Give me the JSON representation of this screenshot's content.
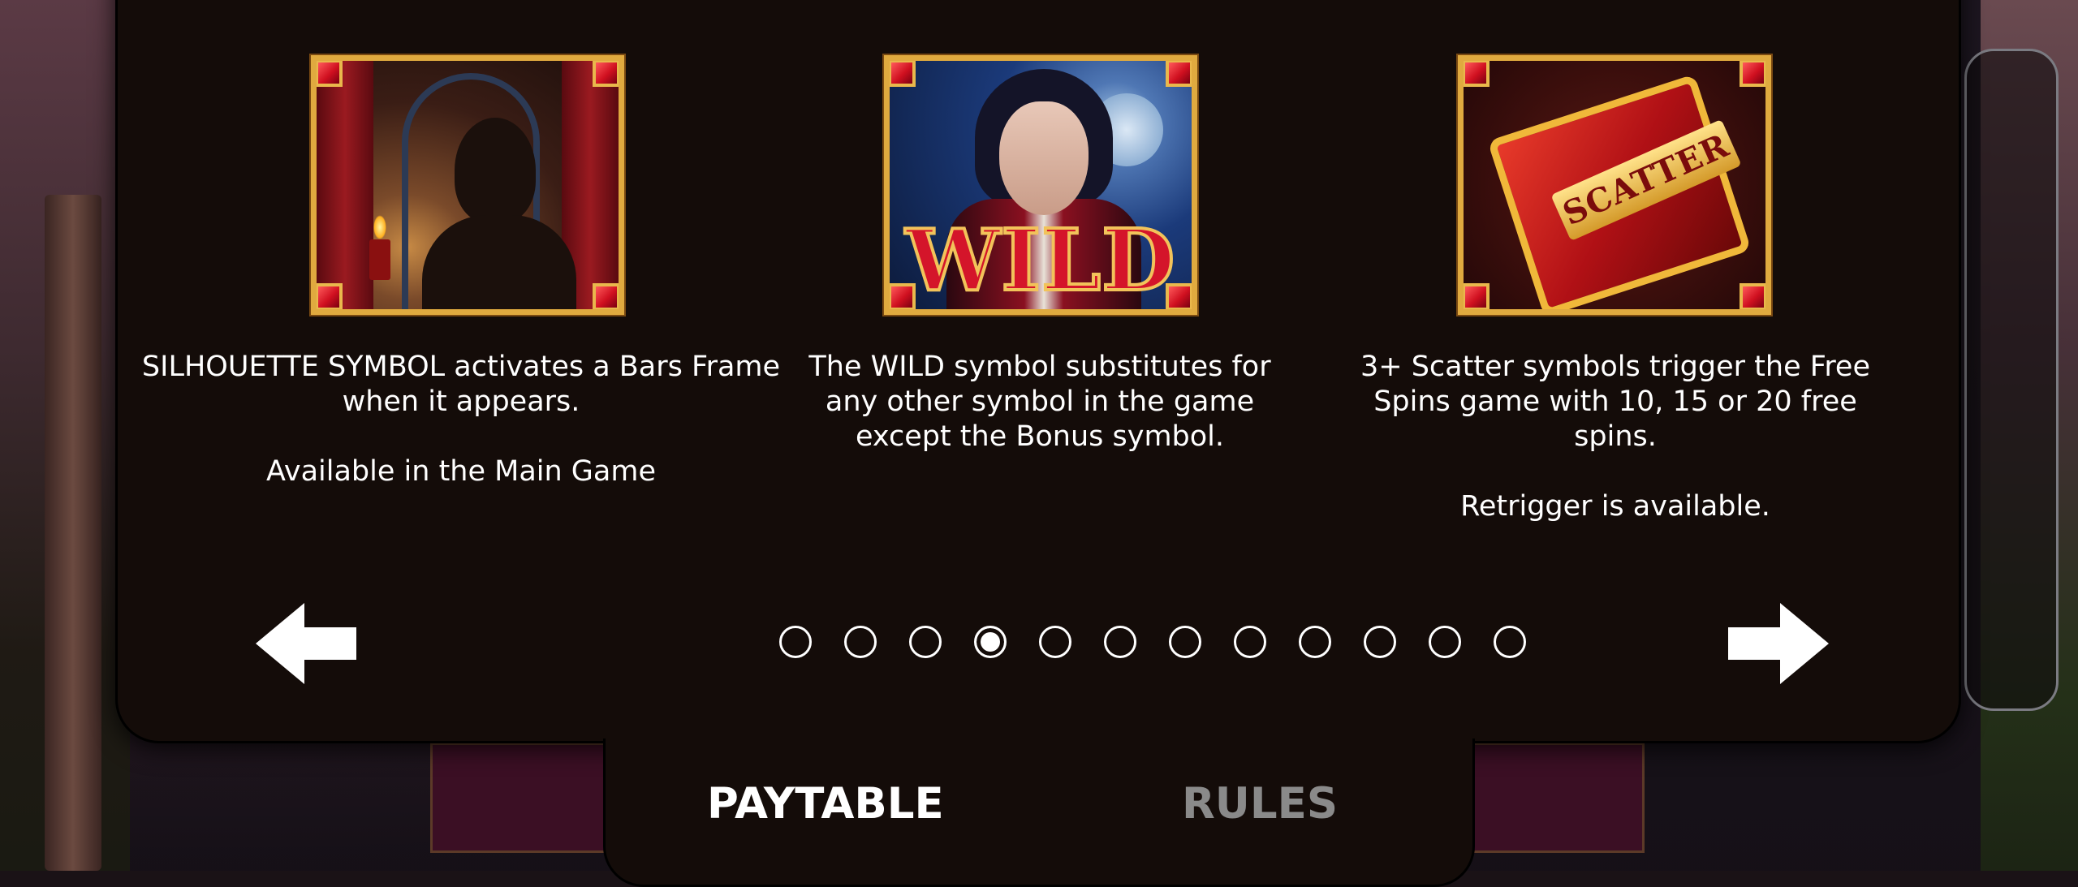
{
  "symbols": [
    {
      "id": "silhouette",
      "lines_1": [
        "SILHOUETTE SYMBOL activates a Bars Frame",
        "when it appears."
      ],
      "lines_2": [
        "Available in the Main Game"
      ]
    },
    {
      "id": "wild",
      "label": "WILD",
      "lines_1": [
        "The WILD symbol substitutes for",
        "any other symbol in the game",
        "except the Bonus symbol."
      ],
      "lines_2": []
    },
    {
      "id": "scatter",
      "label": "SCATTER",
      "lines_1": [
        "3+ Scatter symbols trigger the Free",
        "Spins game with 10, 15 or 20 free",
        "spins."
      ],
      "lines_2": [
        "Retrigger is available."
      ]
    }
  ],
  "pagination": {
    "total": 12,
    "active_index": 3
  },
  "navigation": {
    "prev_icon": "arrow-left-icon",
    "next_icon": "arrow-right-icon"
  },
  "tabs": [
    {
      "label": "PAYTABLE",
      "active": true
    },
    {
      "label": "RULES",
      "active": false
    }
  ],
  "colors": {
    "panel": "#140c09",
    "frame_gold": "#e0aa3f",
    "gem_red": "#d01020",
    "text": "#ffffff",
    "inactive_tab": "#8a8a8a"
  }
}
